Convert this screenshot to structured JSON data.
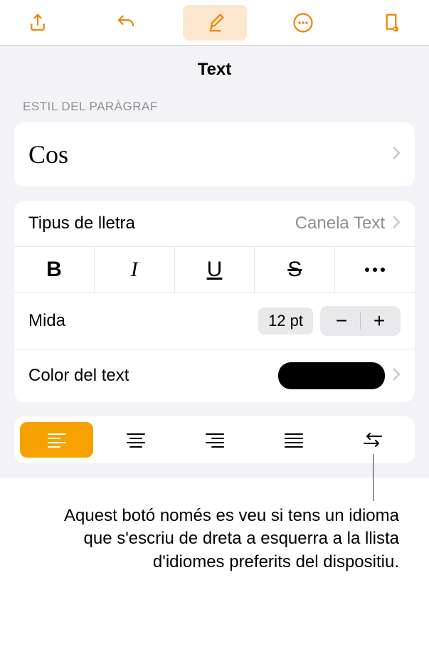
{
  "panel": {
    "title": "Text"
  },
  "paragraph": {
    "label": "ESTIL DEL PARÀGRAF",
    "style": "Cos"
  },
  "font": {
    "label": "Tipus de lletra",
    "value": "Canela Text"
  },
  "styleButtons": {
    "bold": "B",
    "italic": "I",
    "underline": "U",
    "strike": "S"
  },
  "size": {
    "label": "Mida",
    "value": "12 pt"
  },
  "textColor": {
    "label": "Color del text"
  },
  "callout": "Aquest botó només es veu si tens un idioma que s'escriu de dreta a esquerra a la llista d'idiomes preferits del dispositiu."
}
